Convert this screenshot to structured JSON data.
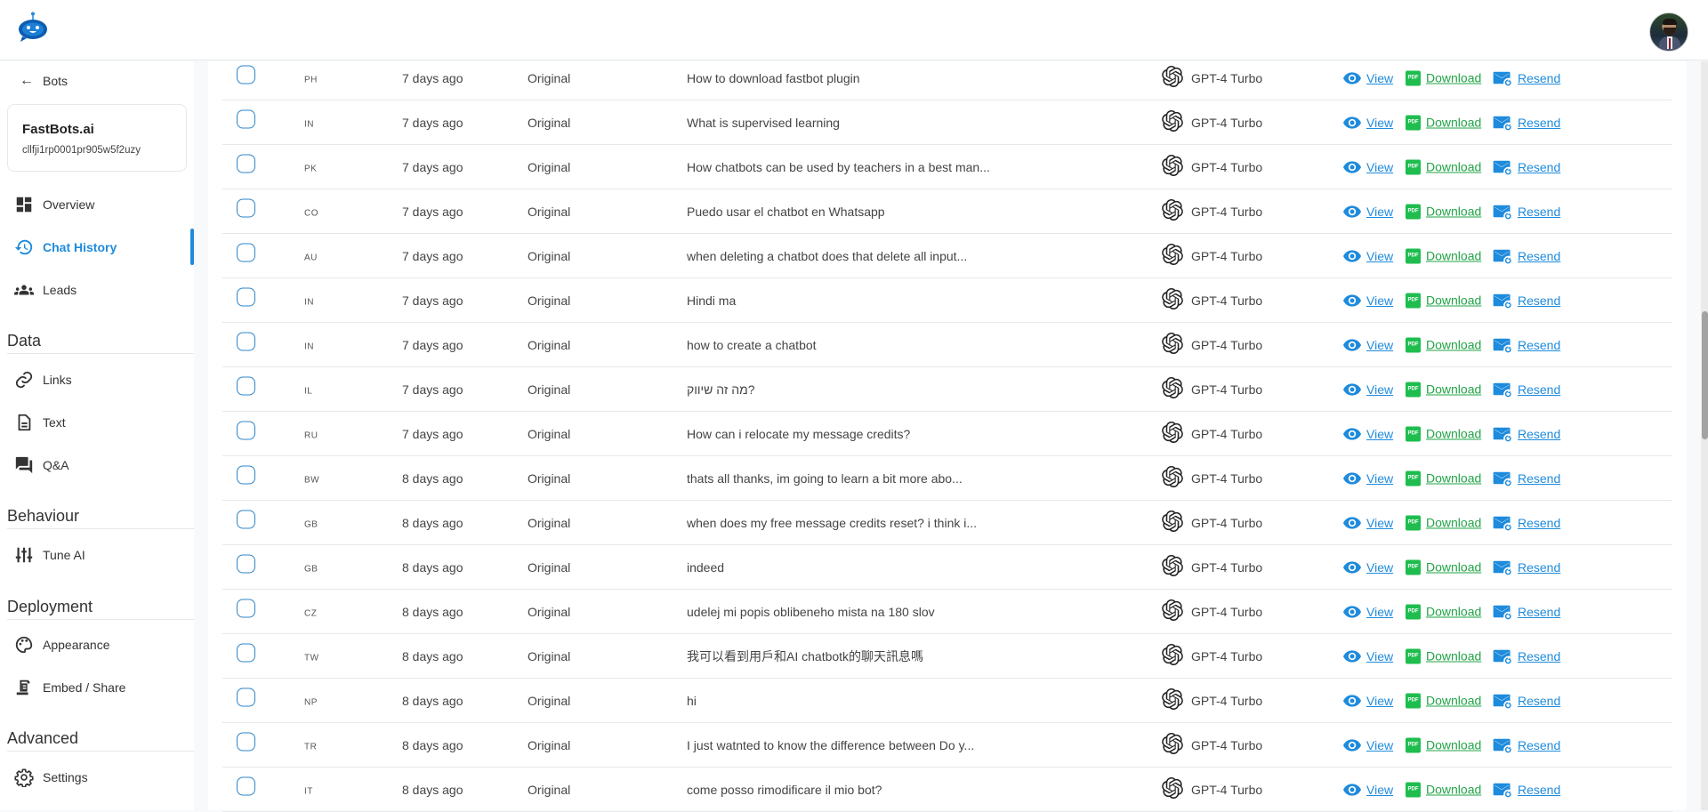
{
  "header": {
    "logo": "fastbots-robot-logo",
    "avatar": "user-avatar"
  },
  "sidebar": {
    "back_label": "Bots",
    "bot": {
      "name": "FastBots.ai",
      "id": "cllfji1rp0001pr905w5f2uzy"
    },
    "main_items": [
      {
        "label": "Overview",
        "icon": "dashboard-icon",
        "active": false
      },
      {
        "label": "Chat History",
        "icon": "history-icon",
        "active": true
      },
      {
        "label": "Leads",
        "icon": "people-icon",
        "active": false
      }
    ],
    "sections": [
      {
        "title": "Data",
        "items": [
          {
            "label": "Links",
            "icon": "link-icon"
          },
          {
            "label": "Text",
            "icon": "document-icon"
          },
          {
            "label": "Q&A",
            "icon": "forum-icon"
          }
        ]
      },
      {
        "title": "Behaviour",
        "items": [
          {
            "label": "Tune AI",
            "icon": "tune-sliders-icon"
          }
        ]
      },
      {
        "title": "Deployment",
        "items": [
          {
            "label": "Appearance",
            "icon": "palette-icon"
          },
          {
            "label": "Embed / Share",
            "icon": "embed-icon"
          }
        ]
      },
      {
        "title": "Advanced",
        "items": [
          {
            "label": "Settings",
            "icon": "gear-icon"
          }
        ]
      }
    ]
  },
  "table": {
    "actions": {
      "view": "View",
      "download": "Download",
      "resend": "Resend"
    },
    "rows": [
      {
        "country": "PH",
        "time": "7 days ago",
        "type": "Original",
        "message": "How to download fastbot plugin",
        "model": "GPT-4 Turbo"
      },
      {
        "country": "IN",
        "time": "7 days ago",
        "type": "Original",
        "message": "What is supervised learning",
        "model": "GPT-4 Turbo"
      },
      {
        "country": "PK",
        "time": "7 days ago",
        "type": "Original",
        "message": "How chatbots can be used by teachers in a best man...",
        "model": "GPT-4 Turbo"
      },
      {
        "country": "CO",
        "time": "7 days ago",
        "type": "Original",
        "message": "Puedo usar el chatbot en Whatsapp",
        "model": "GPT-4 Turbo"
      },
      {
        "country": "AU",
        "time": "7 days ago",
        "type": "Original",
        "message": "when deleting a chatbot does that delete all input...",
        "model": "GPT-4 Turbo"
      },
      {
        "country": "IN",
        "time": "7 days ago",
        "type": "Original",
        "message": "Hindi ma",
        "model": "GPT-4 Turbo"
      },
      {
        "country": "IN",
        "time": "7 days ago",
        "type": "Original",
        "message": "how to create a chatbot",
        "model": "GPT-4 Turbo"
      },
      {
        "country": "IL",
        "time": "7 days ago",
        "type": "Original",
        "message": "מה זה שיווק?",
        "model": "GPT-4 Turbo"
      },
      {
        "country": "RU",
        "time": "7 days ago",
        "type": "Original",
        "message": "How can i relocate my message credits?",
        "model": "GPT-4 Turbo"
      },
      {
        "country": "BW",
        "time": "8 days ago",
        "type": "Original",
        "message": "thats all thanks, im going to learn a bit more abo...",
        "model": "GPT-4 Turbo"
      },
      {
        "country": "GB",
        "time": "8 days ago",
        "type": "Original",
        "message": "when does my free message credits reset? i think i...",
        "model": "GPT-4 Turbo"
      },
      {
        "country": "GB",
        "time": "8 days ago",
        "type": "Original",
        "message": "indeed",
        "model": "GPT-4 Turbo"
      },
      {
        "country": "CZ",
        "time": "8 days ago",
        "type": "Original",
        "message": "udelej mi popis oblibeneho mista na 180 slov",
        "model": "GPT-4 Turbo"
      },
      {
        "country": "TW",
        "time": "8 days ago",
        "type": "Original",
        "message": "我可以看到用戶和AI chatbotk的聊天訊息嗎",
        "model": "GPT-4 Turbo"
      },
      {
        "country": "NP",
        "time": "8 days ago",
        "type": "Original",
        "message": "hi",
        "model": "GPT-4 Turbo"
      },
      {
        "country": "TR",
        "time": "8 days ago",
        "type": "Original",
        "message": "I just watnted to know the difference between Do y...",
        "model": "GPT-4 Turbo"
      },
      {
        "country": "IT",
        "time": "8 days ago",
        "type": "Original",
        "message": "come posso rimodificare il mio bot?",
        "model": "GPT-4 Turbo"
      }
    ]
  },
  "colors": {
    "accent": "#1e8bdc",
    "download": "#22a447",
    "pdf_badge": "#1ebd4e"
  }
}
